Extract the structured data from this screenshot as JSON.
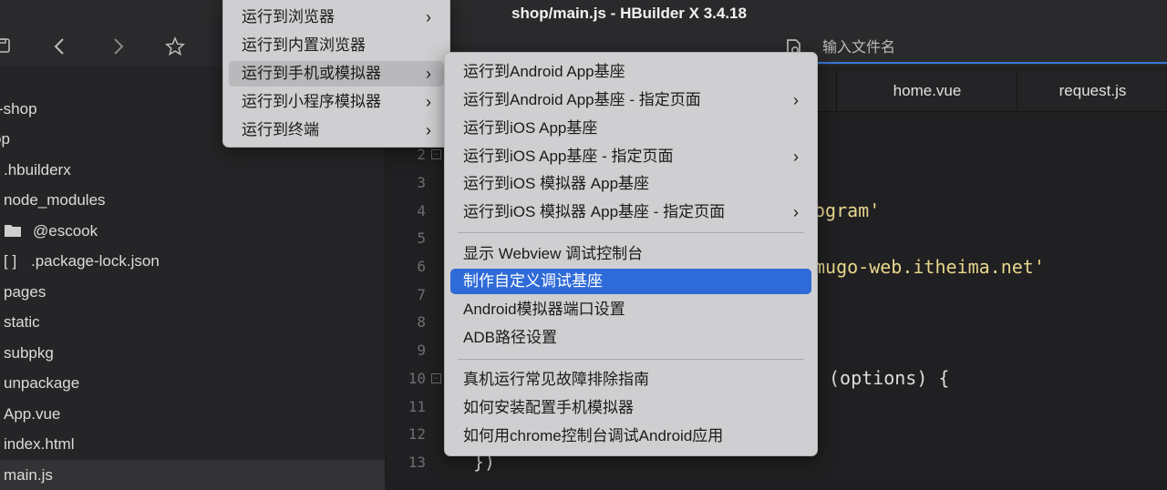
{
  "window": {
    "title": "shop/main.js - HBuilder X 3.4.18"
  },
  "toolbar": {
    "search_placeholder": "输入文件名"
  },
  "sidebar": {
    "items": [
      {
        "label": "-shop"
      },
      {
        "label": "op"
      },
      {
        "label": ".hbuilderx"
      },
      {
        "label": "node_modules"
      },
      {
        "label": "@escook"
      },
      {
        "label": ".package-lock.json",
        "prefix": "[ ]"
      },
      {
        "label": "pages"
      },
      {
        "label": "static"
      },
      {
        "label": "subpkg"
      },
      {
        "label": "unpackage"
      },
      {
        "label": "App.vue"
      },
      {
        "label": "index.html"
      },
      {
        "label": "main.js"
      }
    ]
  },
  "editor": {
    "tabs": [
      {
        "label": "home.vue"
      },
      {
        "label": "request.js"
      }
    ],
    "line_numbers": [
      "2",
      "3",
      "4",
      "5",
      "6",
      "7",
      "8",
      "9",
      "10",
      "11",
      "12",
      "13"
    ],
    "code_fragments": {
      "line4": "ogram'",
      "line6": "mugo-web.itheima.net'",
      "line10": "(options) {",
      "line13": "})"
    }
  },
  "menu_main": {
    "items": [
      {
        "label": "运行到浏览器",
        "submenu": true
      },
      {
        "label": "运行到内置浏览器",
        "submenu": false
      },
      {
        "label": "运行到手机或模拟器",
        "submenu": true
      },
      {
        "label": "运行到小程序模拟器",
        "submenu": true
      },
      {
        "label": "运行到终端",
        "submenu": true
      }
    ]
  },
  "menu_sub": {
    "items": [
      {
        "label": "运行到Android App基座",
        "submenu": false
      },
      {
        "label": "运行到Android App基座 - 指定页面",
        "submenu": true
      },
      {
        "label": "运行到iOS App基座",
        "submenu": false
      },
      {
        "label": "运行到iOS App基座 - 指定页面",
        "submenu": true
      },
      {
        "label": "运行到iOS 模拟器 App基座",
        "submenu": false
      },
      {
        "label": "运行到iOS 模拟器 App基座 - 指定页面",
        "submenu": true
      },
      {
        "label": "显示 Webview 调试控制台",
        "submenu": false
      },
      {
        "label": "制作自定义调试基座",
        "submenu": false,
        "highlighted": true
      },
      {
        "label": "Android模拟器端口设置",
        "submenu": false
      },
      {
        "label": "ADB路径设置",
        "submenu": false
      },
      {
        "label": "真机运行常见故障排除指南",
        "submenu": false
      },
      {
        "label": "如何安装配置手机模拟器",
        "submenu": false
      },
      {
        "label": "如何用chrome控制台调试Android应用",
        "submenu": false
      }
    ]
  },
  "colors": {
    "accent": "#2f6bd8",
    "string": "#e8d68c",
    "menu_bg": "#cfcfd1"
  }
}
